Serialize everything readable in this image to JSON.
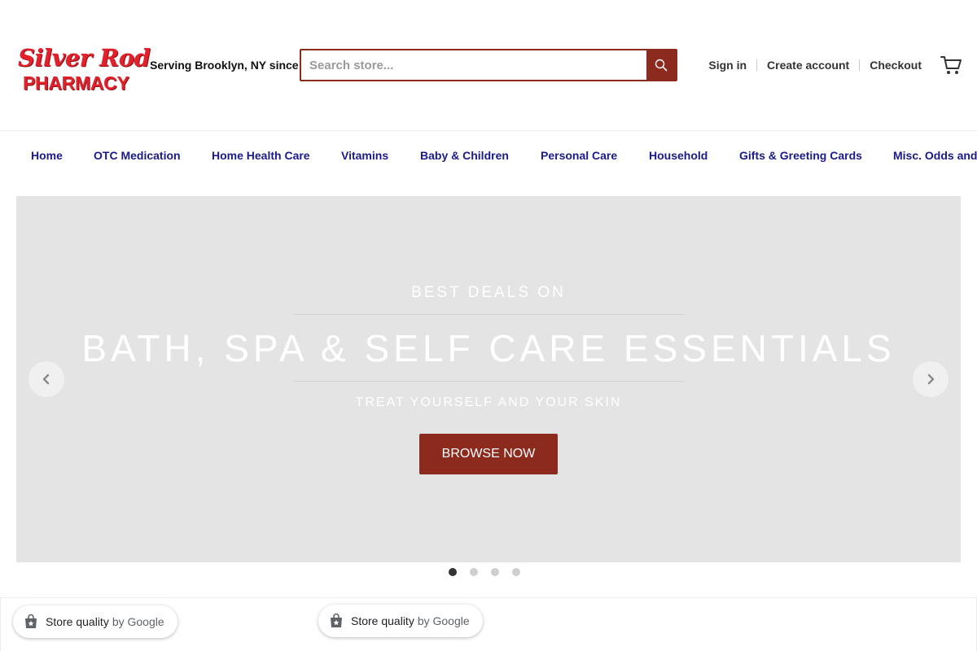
{
  "header": {
    "logo": {
      "line1": "Silver Rod",
      "line2": "PHARMACY"
    },
    "tagline": "Serving Brooklyn, NY since",
    "search": {
      "placeholder": "Search store...",
      "icon": "search-icon"
    },
    "account": {
      "sign_in": "Sign in",
      "create_account": "Create account",
      "checkout": "Checkout"
    },
    "cart_icon": "shopping-cart-icon"
  },
  "nav": {
    "items": [
      {
        "label": "Home"
      },
      {
        "label": "OTC Medication"
      },
      {
        "label": "Home Health Care"
      },
      {
        "label": "Vitamins"
      },
      {
        "label": "Baby & Children"
      },
      {
        "label": "Personal Care"
      },
      {
        "label": "Household"
      },
      {
        "label": "Gifts & Greeting Cards"
      },
      {
        "label": "Misc. Odds and"
      }
    ]
  },
  "hero": {
    "kicker": "BEST DEALS ON",
    "title": "BATH, SPA & SELF CARE ESSENTIALS",
    "subtitle": "TREAT YOURSELF AND YOUR SKIN",
    "button": "BROWSE NOW",
    "slides": 4,
    "active_slide": 1
  },
  "badges": [
    {
      "label": "Store quality",
      "by": "by Google"
    },
    {
      "label": "Store quality",
      "by": "by Google"
    }
  ],
  "colors": {
    "brand_red": "#e4202a",
    "accent": "#8c2a1e",
    "nav_text": "#1a1a8c",
    "hero_bg": "#e4e4e4"
  }
}
